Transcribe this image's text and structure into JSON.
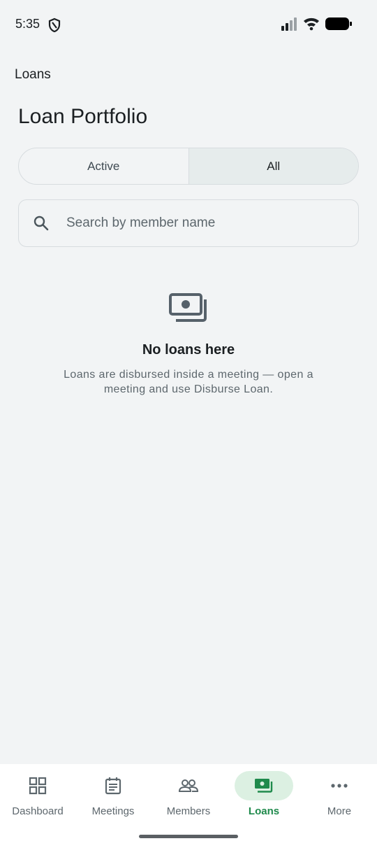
{
  "status_bar": {
    "time": "5:35"
  },
  "app_bar": {
    "title": "Loans"
  },
  "page": {
    "title": "Loan Portfolio"
  },
  "filter": {
    "options": [
      "Active",
      "All"
    ],
    "selected": "All"
  },
  "search": {
    "placeholder": "Search by member name",
    "value": ""
  },
  "empty_state": {
    "icon": "money-icon",
    "title": "No loans here",
    "description": "Loans are disbursed inside a meeting — open a meeting and use Disburse Loan."
  },
  "bottom_nav": {
    "items": [
      {
        "label": "Dashboard",
        "icon": "dashboard-icon"
      },
      {
        "label": "Meetings",
        "icon": "meetings-icon"
      },
      {
        "label": "Members",
        "icon": "members-icon"
      },
      {
        "label": "Loans",
        "icon": "loans-icon"
      },
      {
        "label": "More",
        "icon": "more-icon"
      }
    ],
    "selected": "Loans"
  },
  "colors": {
    "accent": "#1f8a4c",
    "accent_bg": "#dcf0e2",
    "background": "#f2f4f5"
  }
}
